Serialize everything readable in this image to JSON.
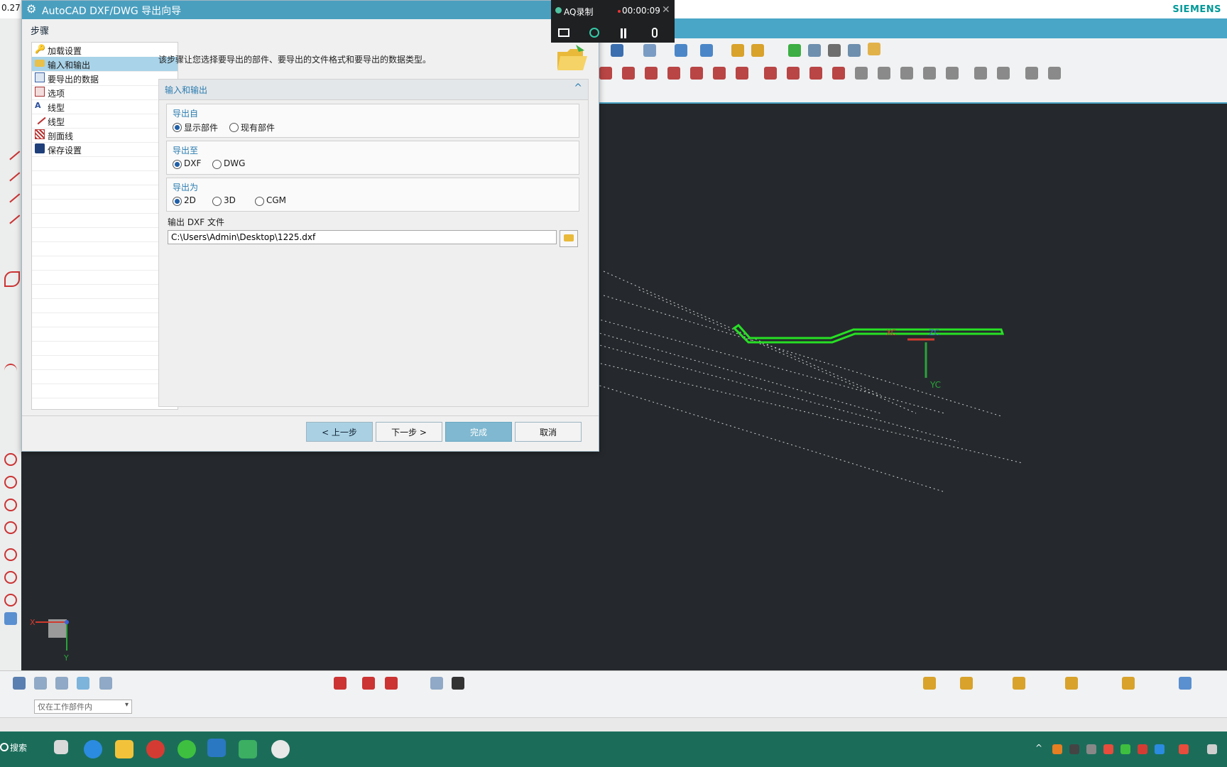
{
  "app": {
    "version_fragment": "0.27",
    "brand": "SIEMENS"
  },
  "recorder": {
    "name": "AQ录制",
    "time": "00:00:09",
    "close": "✕"
  },
  "dialog": {
    "title": "AutoCAD DXF/DWG 导出向导",
    "steps_label": "步骤",
    "steps": [
      {
        "label": "加载设置"
      },
      {
        "label": "输入和输出"
      },
      {
        "label": "要导出的数据"
      },
      {
        "label": "选项"
      },
      {
        "label": "线型"
      },
      {
        "label": "线型"
      },
      {
        "label": "剖面线"
      },
      {
        "label": "保存设置"
      }
    ],
    "selected_step": 1,
    "description": "该步骤让您选择要导出的部件、要导出的文件格式和要导出的数据类型。",
    "group_title": "输入和输出",
    "export_from": {
      "heading": "导出自",
      "options": [
        "显示部件",
        "现有部件"
      ],
      "selected": "显示部件"
    },
    "export_to": {
      "heading": "导出至",
      "options": [
        "DXF",
        "DWG"
      ],
      "selected": "DXF"
    },
    "export_as": {
      "heading": "导出为",
      "options": [
        "2D",
        "3D",
        "CGM"
      ],
      "selected": "2D"
    },
    "file_label": "输出 DXF 文件",
    "file_value": "C:\\Users\\Admin\\Desktop\\1225.dxf",
    "buttons": {
      "back": "< 上一步",
      "next": "下一步 >",
      "finish": "完成",
      "cancel": "取消"
    }
  },
  "viewport": {
    "axis_labels": {
      "xc": "XC",
      "yc": "YC",
      "zc": "ZC",
      "x": "X",
      "y": "Y"
    },
    "curve_color": "#27e024",
    "dim_line_color": "#cfcfcf"
  },
  "statusline": {
    "filter_value": "仅在工作部件内"
  },
  "taskbar": {
    "search": "搜索",
    "color": "#1b6d5a"
  }
}
